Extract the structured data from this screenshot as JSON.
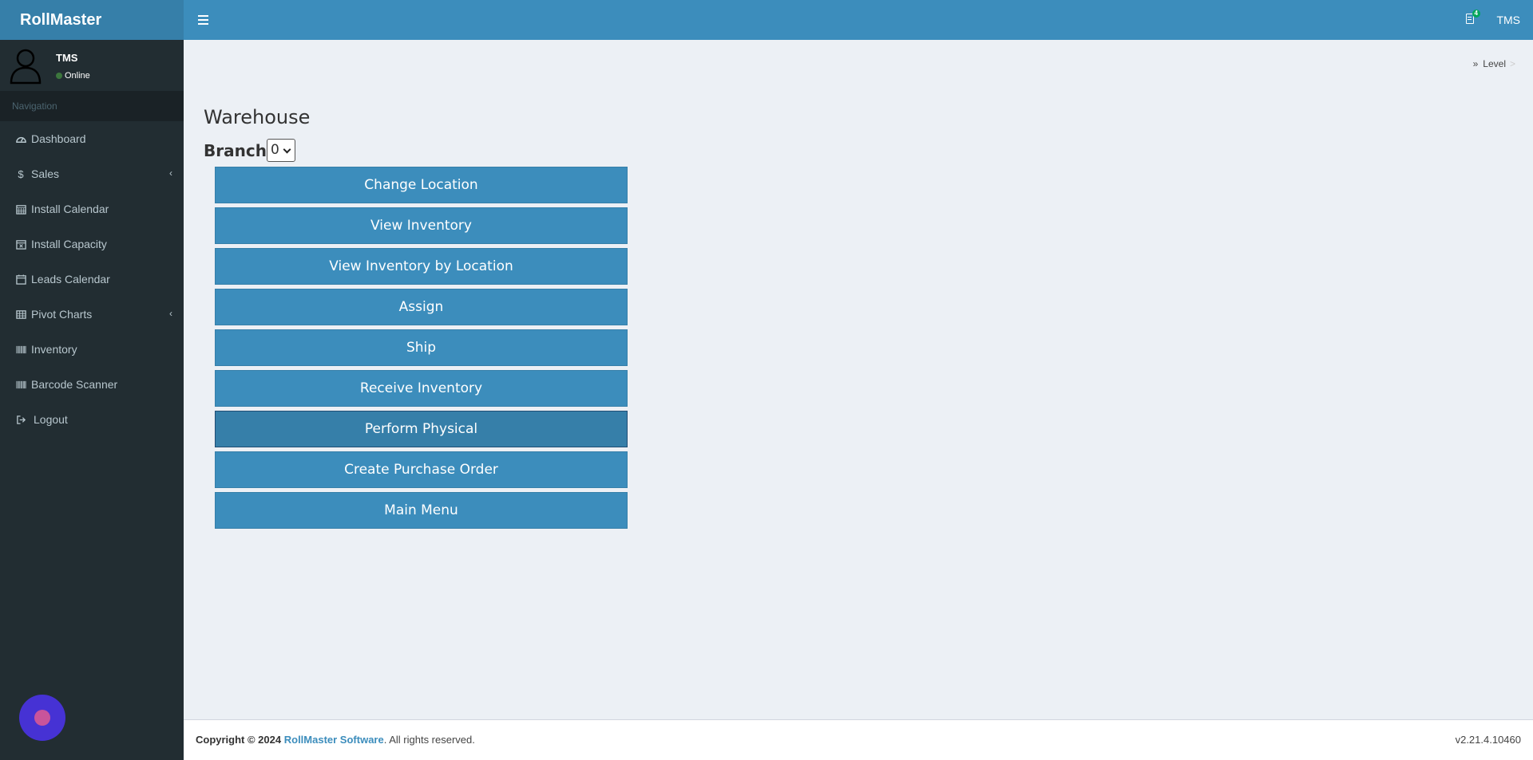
{
  "header": {
    "app_name": "RollMaster",
    "notification_count": "4",
    "user": "TMS"
  },
  "sidebar": {
    "user_name": "TMS",
    "status": "Online",
    "nav_header": "Navigation",
    "items": [
      {
        "label": "Dashboard",
        "icon": "dashboard-icon"
      },
      {
        "label": "Sales",
        "icon": "dollar-icon"
      },
      {
        "label": "Install Calendar",
        "icon": "calendar-icon"
      },
      {
        "label": "Install Capacity",
        "icon": "calendar-x-icon"
      },
      {
        "label": "Leads Calendar",
        "icon": "calendar-o-icon"
      },
      {
        "label": "Pivot Charts",
        "icon": "table-icon"
      },
      {
        "label": "Inventory",
        "icon": "barcode-icon"
      },
      {
        "label": "Barcode Scanner",
        "icon": "barcode-icon"
      },
      {
        "label": "Logout",
        "icon": "sign-out-icon"
      }
    ]
  },
  "breadcrumb": {
    "level": "Level",
    "separator": ">"
  },
  "main": {
    "title": "Warehouse",
    "branch_label": "Branch",
    "branch_value": "0",
    "buttons": [
      "Change Location",
      "View Inventory",
      "View Inventory by Location",
      "Assign",
      "Ship",
      "Receive Inventory",
      "Perform Physical",
      "Create Purchase Order",
      "Main Menu"
    ]
  },
  "footer": {
    "copyright": "Copyright © 2024",
    "brand": "RollMaster Software",
    "rights": ". All rights reserved.",
    "version": "v2.21.4.10460"
  },
  "colors": {
    "header": "#3c8dbc",
    "logo": "#367fa9",
    "sidebar": "#222d32",
    "content_bg": "#ecf0f5"
  }
}
